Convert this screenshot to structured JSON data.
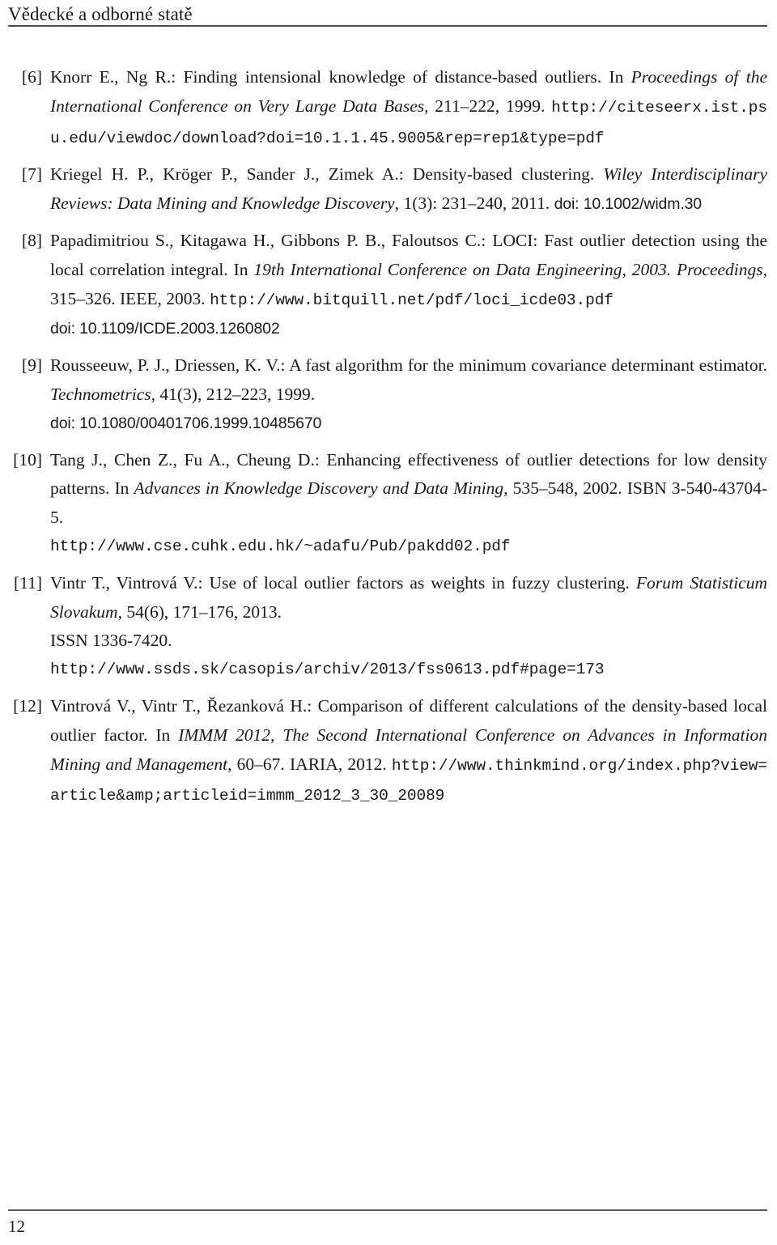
{
  "header": {
    "title": "Vědecké a odborné statě"
  },
  "footer": {
    "page_number": "12"
  },
  "bibliography": {
    "entries": [
      {
        "label": "[6]",
        "authors": "Knorr E., Ng R.",
        "title": "Finding intensional knowledge of distance-based outliers.",
        "in_word": "In",
        "venue": "Proceedings of the International Conference on Very Large Data Bases",
        "pages_year": ", 211–222, 1999. ",
        "url": "http://citeseerx.ist.psu.edu/viewdoc/download?doi=10.1.1.45.9005&rep=rep1&type=pdf",
        "doi": ""
      },
      {
        "label": "[7]",
        "authors": "Kriegel H. P., Kröger P., Sander J., Zimek A.",
        "title": "Density-based clustering.",
        "in_word": "",
        "venue": "Wiley Interdisciplinary Reviews: Data Mining and Knowledge Discovery",
        "pages_year": ", 1(3): 231–240, 2011. ",
        "url": "",
        "doi": "doi: 10.1002/widm.30"
      },
      {
        "label": "[8]",
        "authors": "Papadimitriou S., Kitagawa H., Gibbons P. B., Faloutsos C.",
        "title": "LOCI: Fast outlier detection using the local correlation integral.",
        "in_word": "In",
        "venue": "19th International Conference on Data Engineering, 2003. Proceedings",
        "pages_year": ", 315–326. IEEE, 2003. ",
        "url": "http://www.bitquill.net/pdf/loci_icde03.pdf",
        "doi": "doi: 10.1109/ICDE.2003.1260802"
      },
      {
        "label": "[9]",
        "authors": "Rousseeuw, P. J., Driessen, K. V.",
        "title": "A fast algorithm for the minimum covariance determinant estimator.",
        "in_word": "",
        "venue": "Technometrics",
        "pages_year": ", 41(3), 212–223, 1999. ",
        "url": "",
        "doi": "doi: 10.1080/00401706.1999.10485670"
      },
      {
        "label": "[10]",
        "authors": "Tang J., Chen Z., Fu A., Cheung D.",
        "title": "Enhancing effectiveness of outlier detections for low density patterns.",
        "in_word": "In",
        "venue": "Advances in Knowledge Discovery and Data Mining",
        "pages_year": ", 535–548, 2002. ISBN 3-540-43704-5. ",
        "url": "http://www.cse.cuhk.edu.hk/~adafu/Pub/pakdd02.pdf",
        "doi": ""
      },
      {
        "label": "[11]",
        "authors": "Vintr T., Vintrová V.",
        "title": "Use of local outlier factors as weights in fuzzy clustering.",
        "in_word": "",
        "venue": "Forum Statisticum Slovakum",
        "pages_year": ", 54(6), 171–176, 2013. ",
        "issn": "ISSN 1336-7420.",
        "url": "http://www.ssds.sk/casopis/archiv/2013/fss0613.pdf#page=173",
        "doi": ""
      },
      {
        "label": "[12]",
        "authors": "Vintrová V., Vintr T., Řezanková H.",
        "title": "Comparison of different calculations of the density-based local outlier factor.",
        "in_word": "In",
        "venue": "IMMM 2012, The Second International Conference on Advances in Information Mining and Management",
        "pages_year": ", 60–67. IARIA, 2012. ",
        "url": "http://www.thinkmind.org/index.php?view=article&amp;articleid=immm_2012_3_30_20089",
        "doi": ""
      }
    ]
  }
}
